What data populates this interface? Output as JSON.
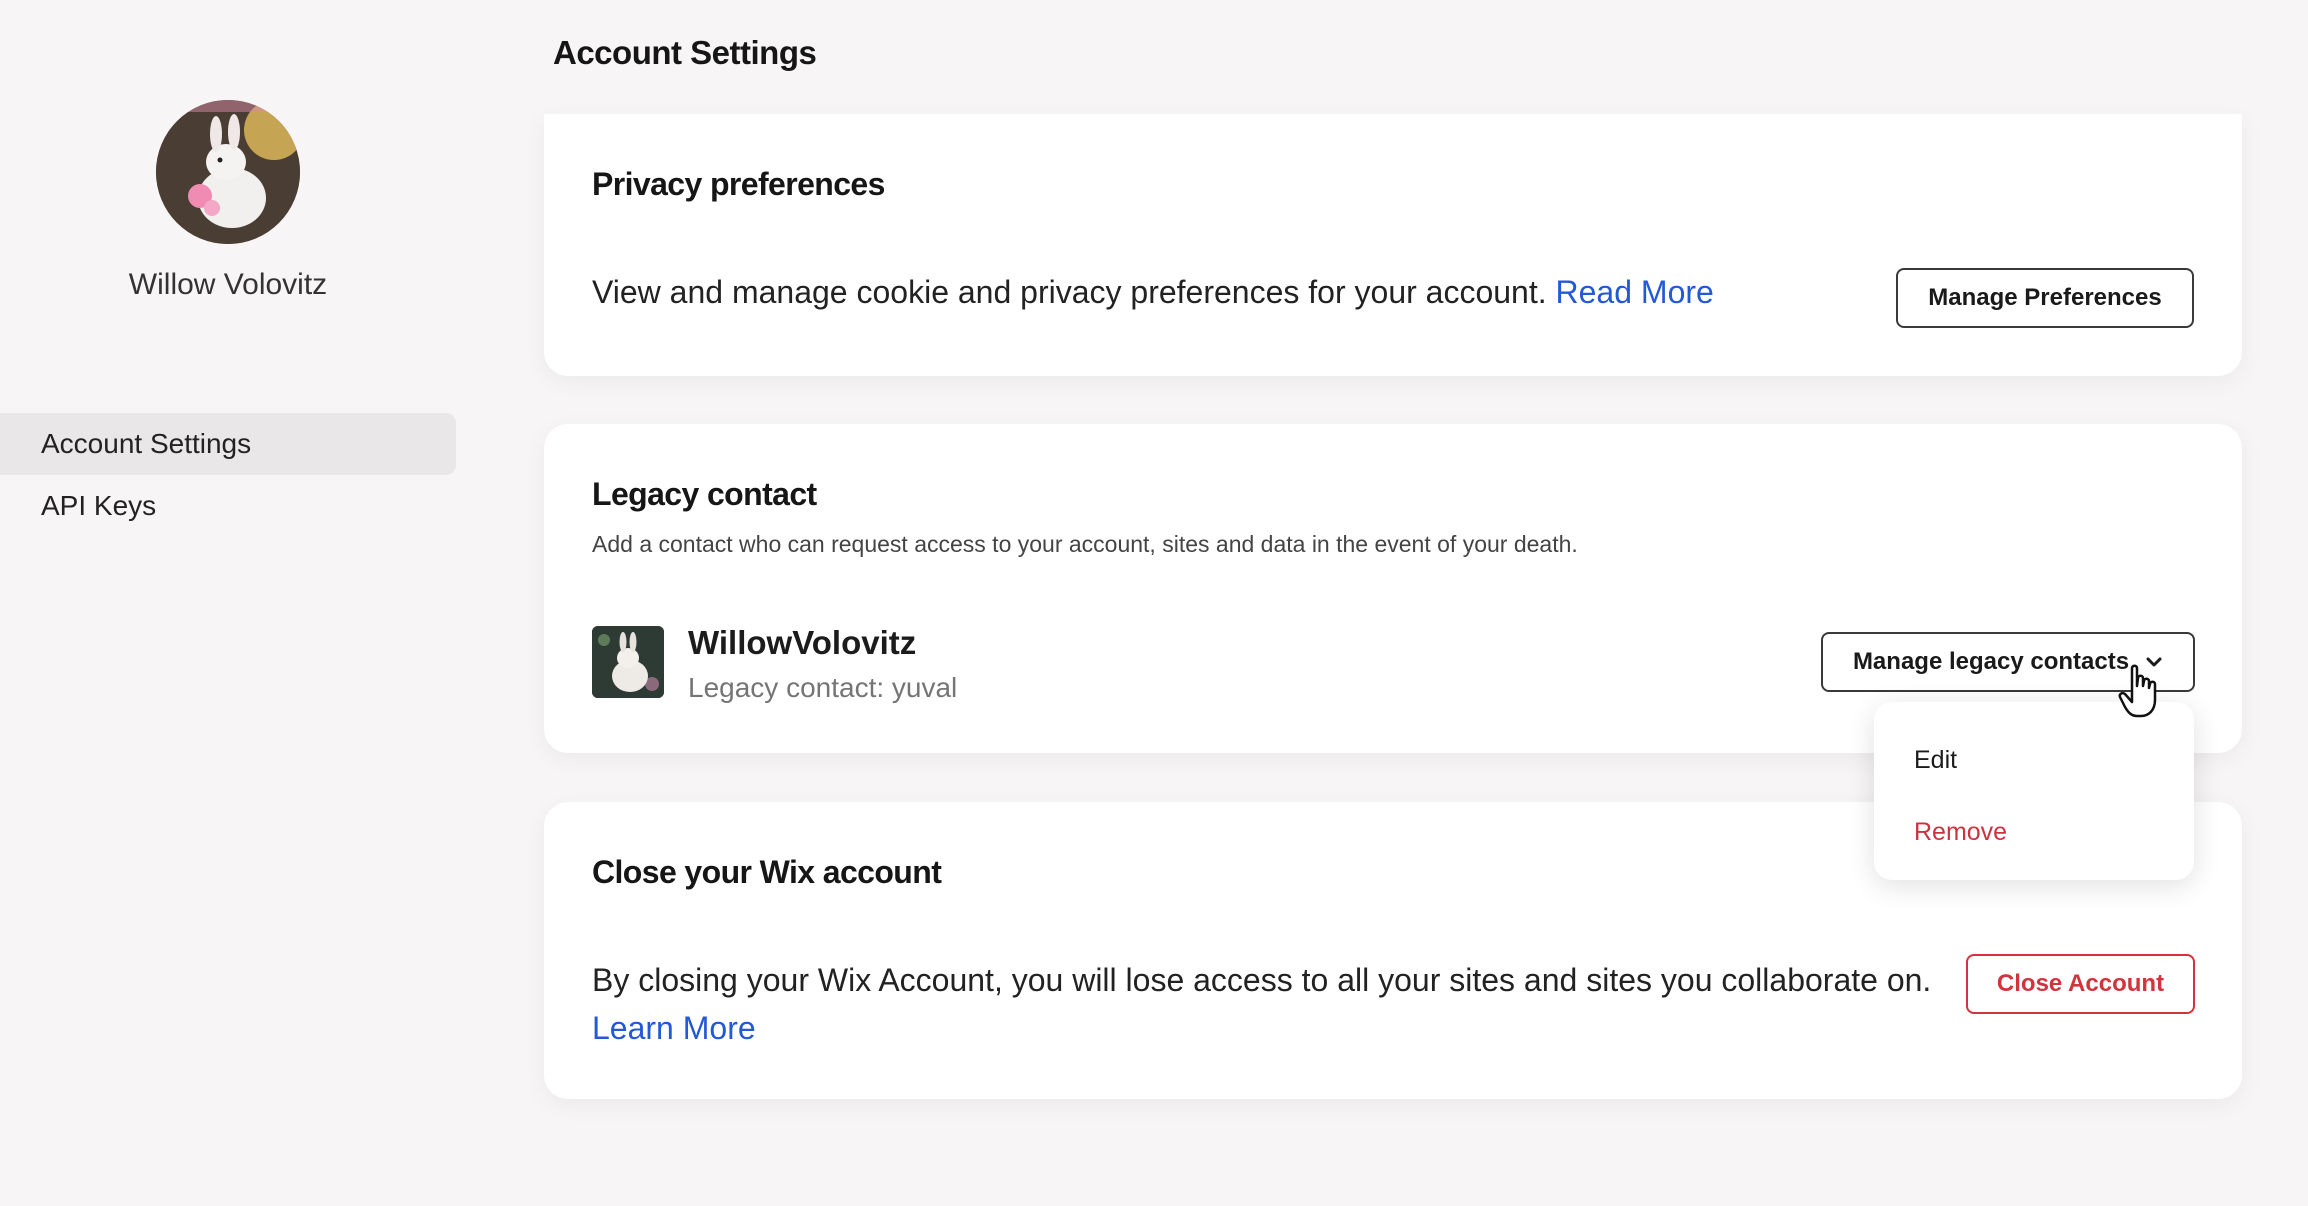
{
  "sidebar": {
    "user_name": "Willow Volovitz",
    "nav": [
      {
        "label": "Account Settings",
        "active": true
      },
      {
        "label": "API Keys",
        "active": false
      }
    ]
  },
  "header": {
    "title": "Account Settings"
  },
  "privacy": {
    "title": "Privacy preferences",
    "description": "View and manage cookie and privacy preferences for your account.",
    "link": "Read More",
    "button": "Manage Preferences"
  },
  "legacy": {
    "title": "Legacy contact",
    "description": "Add a contact who can request access to your account, sites and data in the event of your death.",
    "contact_name": "WillowVolovitz",
    "contact_sub": "Legacy contact: yuval",
    "button": "Manage legacy contacts",
    "menu": {
      "edit": "Edit",
      "remove": "Remove"
    }
  },
  "close": {
    "title": "Close your Wix account",
    "description": "By closing your Wix Account, you will lose access to all your sites and sites you collaborate on.",
    "link": "Learn More",
    "button": "Close Account"
  },
  "colors": {
    "link": "#2459d6",
    "danger": "#d2333c",
    "background": "#f7f5f5"
  }
}
